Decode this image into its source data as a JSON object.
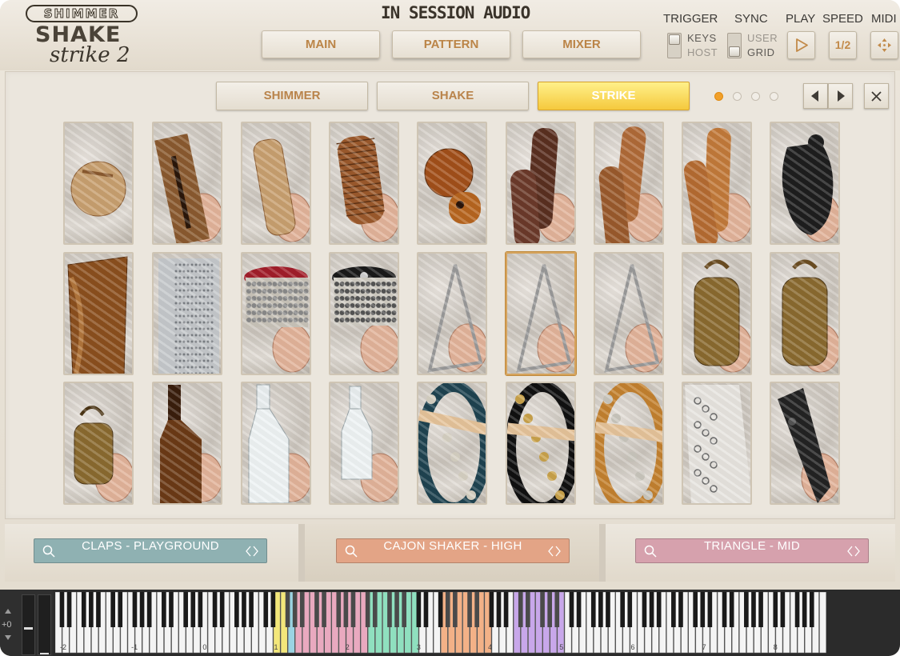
{
  "header": {
    "logo": {
      "line1": "SHIMMER",
      "line2": "SHAKE",
      "line3": "strike 2"
    },
    "brand": "IN SESSION AUDIO",
    "nav": [
      {
        "label": "MAIN"
      },
      {
        "label": "PATTERN"
      },
      {
        "label": "MIXER"
      }
    ],
    "trigger": {
      "label": "TRIGGER",
      "options": [
        "KEYS",
        "HOST"
      ]
    },
    "sync": {
      "label": "SYNC",
      "options": [
        "USER",
        "GRID"
      ]
    },
    "play": {
      "label": "PLAY"
    },
    "speed": {
      "label": "SPEED",
      "value": "1/2"
    },
    "midi": {
      "label": "MIDI"
    }
  },
  "tabs": [
    {
      "label": "SHIMMER",
      "active": false
    },
    {
      "label": "SHAKE",
      "active": false
    },
    {
      "label": "STRIKE",
      "active": true
    }
  ],
  "page_dots": {
    "count": 4,
    "active": 0
  },
  "accent": "#f1a02a",
  "instrument_grid": {
    "rows": 3,
    "cols": 9,
    "selected_row": 1,
    "selected_col": 5,
    "tiles": [
      [
        "woodblock-round",
        "slit-woodblock",
        "wood-tube",
        "guiro-shaker",
        "wood-ball-shaker",
        "wood-sticks-dark",
        "wood-sticks",
        "claves",
        "castanets"
      ],
      [
        "frame-shaker",
        "metal-guiro",
        "cabasa-red",
        "cabasa-black",
        "triangle",
        "triangle",
        "triangle",
        "cowbell",
        "cowbell"
      ],
      [
        "small-bell",
        "bottle-brown",
        "bottle-clear",
        "bottle-small",
        "tambourine-blue",
        "tambourine-black",
        "tambourine-wood",
        "chain-rattle",
        "clacker"
      ]
    ]
  },
  "slots": [
    {
      "label": "CLAPS - PLAYGROUND",
      "color": "#8fb1b2"
    },
    {
      "label": "CAJON SHAKER - HIGH",
      "color": "#e3a486"
    },
    {
      "label": "TRIANGLE - MID",
      "color": "#d6a1ad"
    }
  ],
  "keyboard": {
    "octave_labels": [
      "-2",
      "-1",
      "0",
      "1",
      "2",
      "3",
      "4",
      "5",
      "6",
      "7",
      "8"
    ],
    "transpose": "+0"
  }
}
